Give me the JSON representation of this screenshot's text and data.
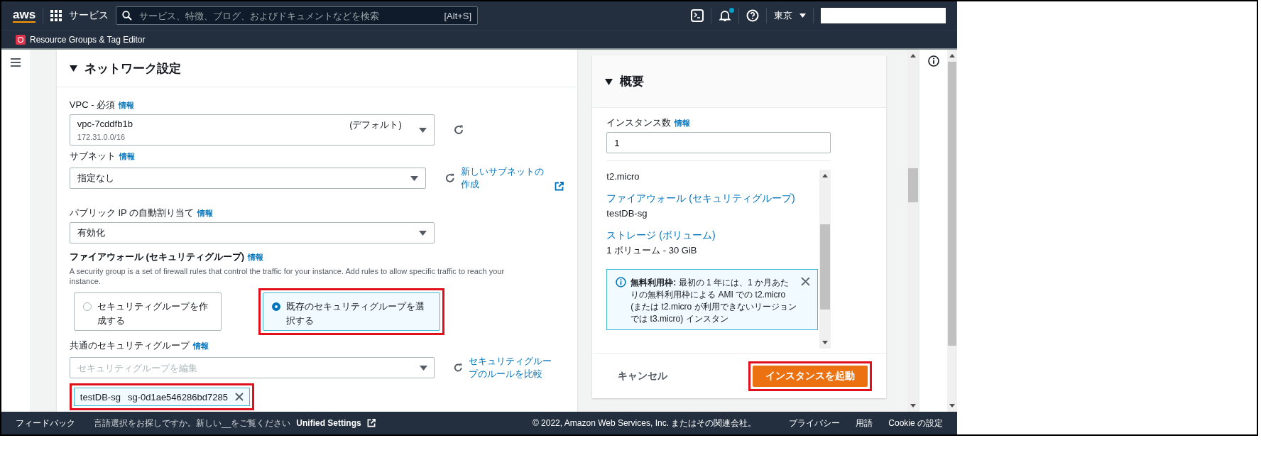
{
  "top_nav": {
    "logo": "aws",
    "services": "サービス",
    "search": {
      "placeholder": "サービス、特徴、ブログ、およびドキュメントなどを検索",
      "shortcut": "[Alt+S]"
    },
    "notifications_unread": true,
    "region": "東京"
  },
  "favorites": [
    {
      "label": "Resource Groups & Tag Editor"
    }
  ],
  "network_settings": {
    "title": "ネットワーク設定",
    "expanded": true,
    "vpc": {
      "label": "VPC - 必須",
      "info": "情報",
      "value": "vpc-7cddfb1b",
      "sub": "172.31.0.0/16",
      "tag": "(デフォルト)"
    },
    "subnet": {
      "label": "サブネット",
      "info": "情報",
      "value": "指定なし",
      "link": "新しいサブネットの作成"
    },
    "public_ip": {
      "label": "パブリック IP の自動割り当て",
      "info": "情報",
      "value": "有効化"
    },
    "firewall": {
      "label": "ファイアウォール (セキュリティグループ)",
      "info": "情報",
      "description": "A security group is a set of firewall rules that control the traffic for your instance. Add rules to allow specific traffic to reach your instance.",
      "options": [
        {
          "label": "セキュリティグループを作成する",
          "selected": false,
          "highlighted": false
        },
        {
          "label": "既存のセキュリティグループを選択する",
          "selected": true,
          "highlighted": true
        }
      ]
    },
    "common_sg": {
      "label": "共通のセキュリティグループ",
      "info": "情報",
      "placeholder": "セキュリティグループを編集",
      "link": "セキュリティグループのルールを比較",
      "tokens": [
        {
          "name": "testDB-sg",
          "id": "sg-0d1ae546286bd7285",
          "highlighted": true
        }
      ]
    }
  },
  "summary": {
    "title": "概要",
    "expanded": true,
    "instances_label": "インスタンス数",
    "info": "情報",
    "instances_value": "1",
    "items": [
      {
        "kind": "text",
        "text": "t2.micro"
      },
      {
        "kind": "link",
        "text": "ファイアウォール (セキュリティグループ)"
      },
      {
        "kind": "text",
        "text": "testDB-sg"
      },
      {
        "kind": "link",
        "text": "ストレージ (ボリューム)"
      },
      {
        "kind": "text",
        "text": "1 ボリューム - 30 GiB"
      }
    ],
    "alert": "**無料利用枠:** 最初の 1 年には、1 か月あたりの無料利用枠による AMI での t2.micro (または t2.micro が利用できないリージョンでは t3.micro) インスタン",
    "cancel": "キャンセル",
    "launch": {
      "label": "インスタンスを起動",
      "highlighted": true
    }
  },
  "footer": {
    "feedback": "フィードバック",
    "language_notice": "言語選択をお探しですか。新しい__をご覧ください",
    "unified_settings": "Unified Settings",
    "copyright": "© 2022, Amazon Web Services, Inc. またはその関連会社。",
    "links": [
      "プライバシー",
      "用語",
      "Cookie の設定"
    ]
  }
}
